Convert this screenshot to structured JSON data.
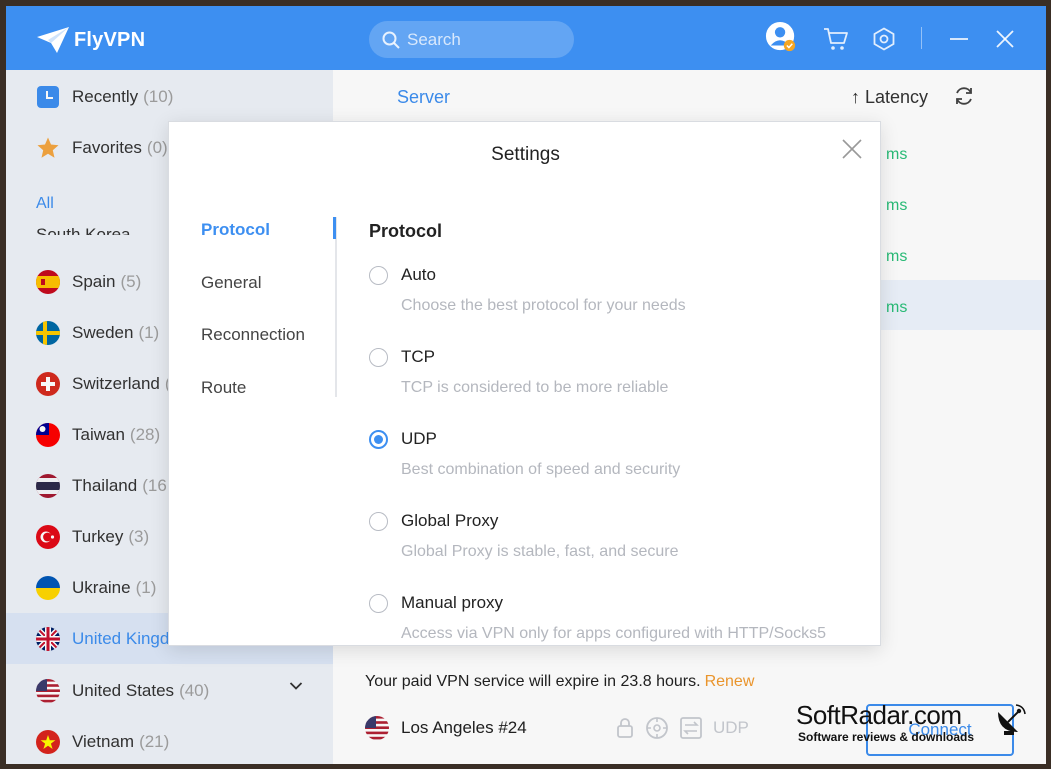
{
  "app": {
    "name": "FlyVPN"
  },
  "search": {
    "placeholder": "Search"
  },
  "sidebar": {
    "recent": {
      "label": "Recently",
      "count": "(10)"
    },
    "favorites": {
      "label": "Favorites",
      "count": "(0)"
    },
    "all_label": "All",
    "partial_label": "South Korea",
    "countries": [
      {
        "name": "Spain",
        "count": "(5)"
      },
      {
        "name": "Sweden",
        "count": "(1)"
      },
      {
        "name": "Switzerland",
        "count": "("
      },
      {
        "name": "Taiwan",
        "count": "(28)"
      },
      {
        "name": "Thailand",
        "count": "(16"
      },
      {
        "name": "Turkey",
        "count": "(3)"
      },
      {
        "name": "Ukraine",
        "count": "(1)"
      },
      {
        "name": "United Kingd",
        "count": ""
      },
      {
        "name": "United States",
        "count": "(40)"
      },
      {
        "name": "Vietnam",
        "count": "(21)"
      }
    ]
  },
  "main": {
    "server_header": "Server",
    "latency_header": "↑ Latency",
    "latencies": [
      "ms",
      "ms",
      "ms",
      "ms"
    ]
  },
  "bottom": {
    "expire_text": "Your paid VPN service will expire in 23.8 hours.",
    "renew_label": "Renew",
    "location": "Los Angeles #24",
    "protocol": "UDP",
    "connect_label": "Connect"
  },
  "dialog": {
    "title": "Settings",
    "nav": [
      "Protocol",
      "General",
      "Reconnection",
      "Route"
    ],
    "section_title": "Protocol",
    "options": [
      {
        "label": "Auto",
        "desc": "Choose the best protocol for your needs",
        "checked": false
      },
      {
        "label": "TCP",
        "desc": "TCP is considered to be more reliable",
        "checked": false
      },
      {
        "label": "UDP",
        "desc": "Best combination of speed and security",
        "checked": true
      },
      {
        "label": "Global Proxy",
        "desc": "Global Proxy is stable, fast, and secure",
        "checked": false
      },
      {
        "label": "Manual proxy",
        "desc": "Access via VPN only for apps configured with HTTP/Socks5",
        "checked": false
      }
    ]
  },
  "watermark": {
    "title": "SoftRadar.com",
    "subtitle": "Software reviews & downloads"
  },
  "colors": {
    "accent": "#3d8ff1",
    "latency_green": "#2bc07a",
    "renew_orange": "#f29a2e",
    "sidebar_bg": "#eef2f8"
  }
}
